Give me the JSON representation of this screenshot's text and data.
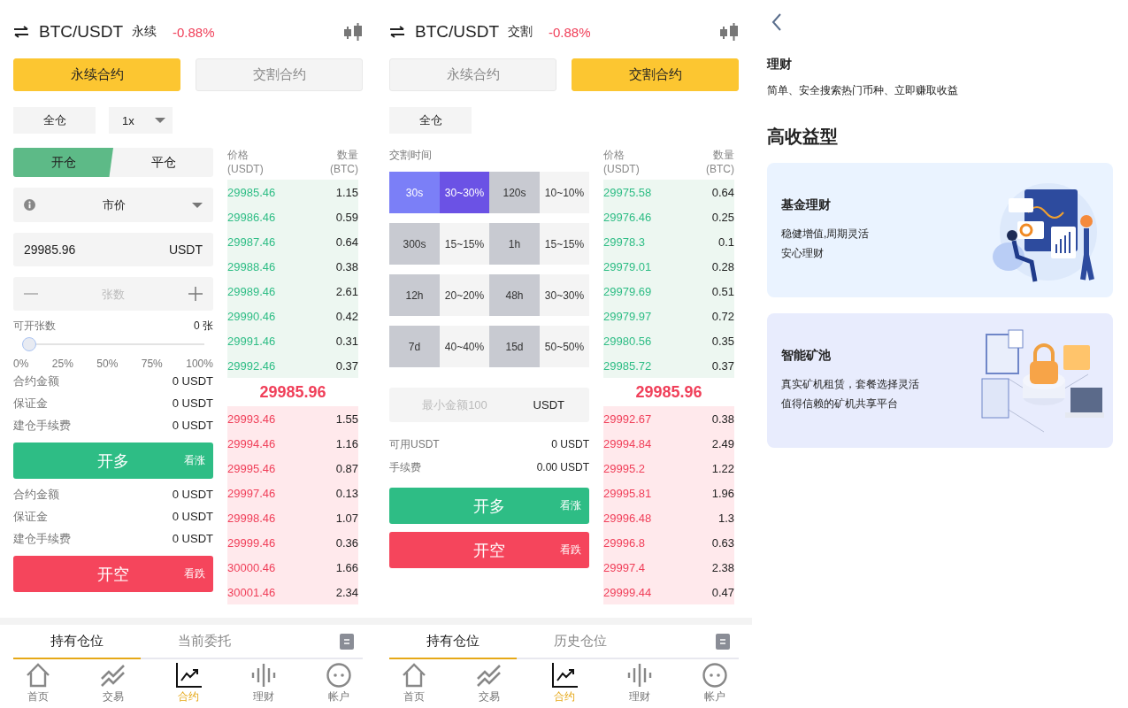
{
  "screens": [
    {
      "kind": "perpetual",
      "header": {
        "pair": "BTC/USDT",
        "contract": "永续",
        "change": "-0.88%"
      },
      "contract_tabs": [
        {
          "label": "永续合约",
          "selected": true
        },
        {
          "label": "交割合约",
          "selected": false
        }
      ],
      "margin_mode": "全仓",
      "leverage": "1x",
      "form": {
        "side_tabs": [
          {
            "label": "开仓",
            "selected": true
          },
          {
            "label": "平仓",
            "selected": false
          }
        ],
        "order_type": "市价",
        "price_input": {
          "value": "29985.96",
          "unit": "USDT"
        },
        "quantity_input": {
          "placeholder": "张数"
        },
        "available": {
          "label": "可开张数",
          "value": "0 张"
        },
        "slider": {
          "level": 0,
          "ticks": [
            "0%",
            "25%",
            "50%",
            "75%",
            "100%"
          ]
        },
        "long_info": [
          {
            "label": "合约金额",
            "value": "0 USDT"
          },
          {
            "label": "保证金",
            "value": "0 USDT"
          },
          {
            "label": "建仓手续费",
            "value": "0 USDT"
          }
        ],
        "long_button": {
          "label": "开多",
          "hint": "看涨"
        },
        "short_info": [
          {
            "label": "合约金额",
            "value": "0 USDT"
          },
          {
            "label": "保证金",
            "value": "0 USDT"
          },
          {
            "label": "建仓手续费",
            "value": "0 USDT"
          }
        ],
        "short_button": {
          "label": "开空",
          "hint": "看跌"
        }
      },
      "order_book": {
        "price_header": [
          "价格",
          "(USDT)"
        ],
        "qty_header": [
          "数量",
          "(BTC)"
        ],
        "upper_rows": [
          {
            "price": "29985.46",
            "qty": "1.15"
          },
          {
            "price": "29986.46",
            "qty": "0.59"
          },
          {
            "price": "29987.46",
            "qty": "0.64"
          },
          {
            "price": "29988.46",
            "qty": "0.38"
          },
          {
            "price": "29989.46",
            "qty": "2.61"
          },
          {
            "price": "29990.46",
            "qty": "0.42"
          },
          {
            "price": "29991.46",
            "qty": "0.31"
          },
          {
            "price": "29992.46",
            "qty": "0.37"
          }
        ],
        "last_price": "29985.96",
        "lower_rows": [
          {
            "price": "29993.46",
            "qty": "1.55"
          },
          {
            "price": "29994.46",
            "qty": "1.16"
          },
          {
            "price": "29995.46",
            "qty": "0.87"
          },
          {
            "price": "29997.46",
            "qty": "0.13"
          },
          {
            "price": "29998.46",
            "qty": "1.07"
          },
          {
            "price": "29999.46",
            "qty": "0.36"
          },
          {
            "price": "30000.46",
            "qty": "1.66"
          },
          {
            "price": "30001.46",
            "qty": "2.34"
          }
        ]
      },
      "position_tabs": [
        {
          "label": "持有仓位",
          "selected": true
        },
        {
          "label": "当前委托",
          "selected": false
        }
      ],
      "nav": [
        {
          "label": "首页",
          "selected": false
        },
        {
          "label": "交易",
          "selected": false
        },
        {
          "label": "合约",
          "selected": true
        },
        {
          "label": "理财",
          "selected": false
        },
        {
          "label": "帐户",
          "selected": false
        }
      ]
    },
    {
      "kind": "delivery",
      "header": {
        "pair": "BTC/USDT",
        "contract": "交割",
        "change": "-0.88%"
      },
      "contract_tabs": [
        {
          "label": "永续合约",
          "selected": false
        },
        {
          "label": "交割合约",
          "selected": true
        }
      ],
      "margin_mode": "全仓",
      "form": {
        "time_label": "交割时间",
        "options": [
          {
            "time": "30s",
            "rate": "30~30%",
            "selected": true
          },
          {
            "time": "120s",
            "rate": "10~10%",
            "selected": false
          },
          {
            "time": "300s",
            "rate": "15~15%",
            "selected": false
          },
          {
            "time": "1h",
            "rate": "15~15%",
            "selected": false
          },
          {
            "time": "12h",
            "rate": "20~20%",
            "selected": false
          },
          {
            "time": "48h",
            "rate": "30~30%",
            "selected": false
          },
          {
            "time": "7d",
            "rate": "40~40%",
            "selected": false
          },
          {
            "time": "15d",
            "rate": "50~50%",
            "selected": false
          }
        ],
        "amount_input": {
          "placeholder": "最小金额100",
          "unit": "USDT"
        },
        "info": [
          {
            "label": "可用USDT",
            "value": "0 USDT"
          },
          {
            "label": "手续费",
            "value": "0.00 USDT"
          }
        ],
        "long_button": {
          "label": "开多",
          "hint": "看涨"
        },
        "short_button": {
          "label": "开空",
          "hint": "看跌"
        }
      },
      "order_book": {
        "price_header": [
          "价格",
          "(USDT)"
        ],
        "qty_header": [
          "数量",
          "(BTC)"
        ],
        "upper_rows": [
          {
            "price": "29975.58",
            "qty": "0.64"
          },
          {
            "price": "29976.46",
            "qty": "0.25"
          },
          {
            "price": "29978.3",
            "qty": "0.1"
          },
          {
            "price": "29979.01",
            "qty": "0.28"
          },
          {
            "price": "29979.69",
            "qty": "0.51"
          },
          {
            "price": "29979.97",
            "qty": "0.72"
          },
          {
            "price": "29980.56",
            "qty": "0.35"
          },
          {
            "price": "29985.72",
            "qty": "0.37"
          }
        ],
        "last_price": "29985.96",
        "lower_rows": [
          {
            "price": "29992.67",
            "qty": "0.38"
          },
          {
            "price": "29994.84",
            "qty": "2.49"
          },
          {
            "price": "29995.2",
            "qty": "1.22"
          },
          {
            "price": "29995.81",
            "qty": "1.96"
          },
          {
            "price": "29996.48",
            "qty": "1.3"
          },
          {
            "price": "29996.8",
            "qty": "0.63"
          },
          {
            "price": "29997.4",
            "qty": "2.38"
          },
          {
            "price": "29999.44",
            "qty": "0.47"
          }
        ]
      },
      "position_tabs": [
        {
          "label": "持有仓位",
          "selected": true
        },
        {
          "label": "历史仓位",
          "selected": false
        }
      ],
      "nav": [
        {
          "label": "首页",
          "selected": false
        },
        {
          "label": "交易",
          "selected": false
        },
        {
          "label": "合约",
          "selected": true
        },
        {
          "label": "理财",
          "selected": false
        },
        {
          "label": "帐户",
          "selected": false
        }
      ]
    }
  ],
  "finance_screen": {
    "title": "理财",
    "subtitle": "简单、安全搜索热门币种、立即赚取收益",
    "section_title": "高收益型",
    "cards": [
      {
        "kind": "fund",
        "title": "基金理财",
        "lines": [
          "稳健增值,周期灵活",
          "安心理财"
        ]
      },
      {
        "kind": "mining",
        "title": "智能矿池",
        "lines": [
          "真实矿机租赁，套餐选择灵活",
          "值得信赖的矿机共享平台"
        ]
      }
    ]
  }
}
